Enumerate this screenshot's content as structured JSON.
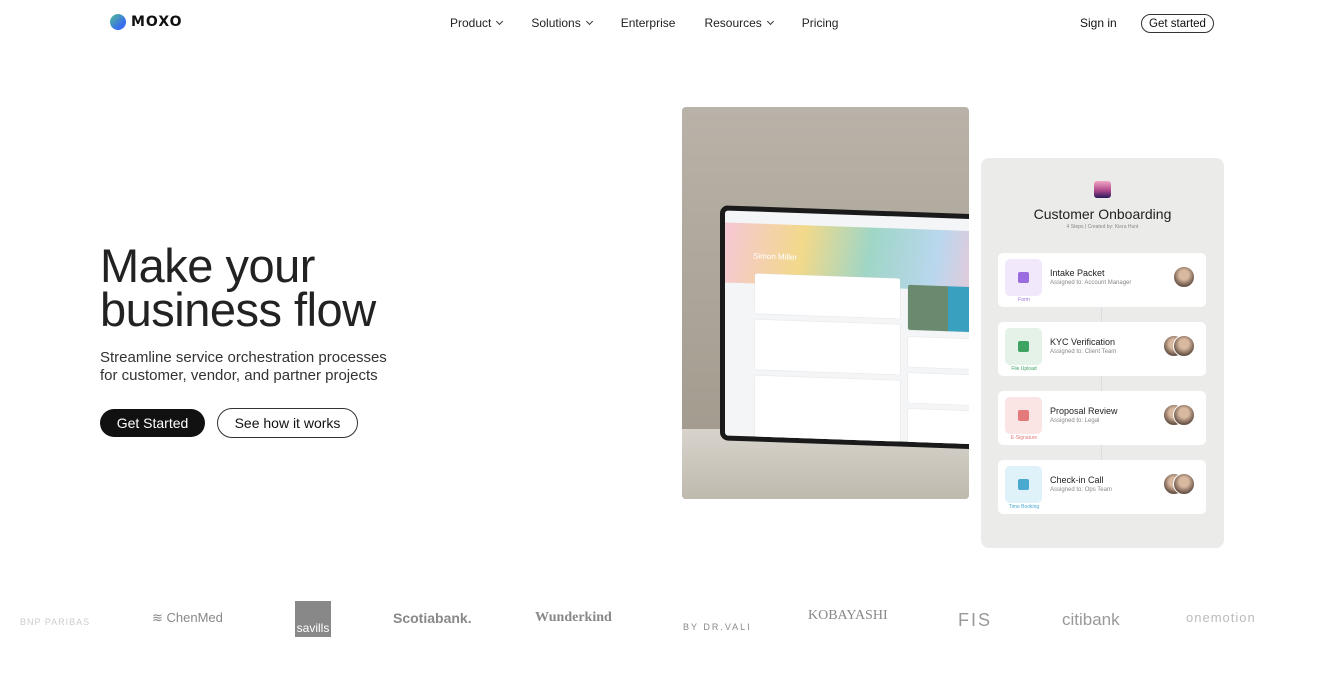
{
  "nav": {
    "brand": "MOXO",
    "items": [
      {
        "label": "Product",
        "dropdown": true
      },
      {
        "label": "Solutions",
        "dropdown": true
      },
      {
        "label": "Enterprise",
        "dropdown": false
      },
      {
        "label": "Resources",
        "dropdown": true
      },
      {
        "label": "Pricing",
        "dropdown": false
      }
    ],
    "sign_in": "Sign in",
    "get_started": "Get started"
  },
  "hero": {
    "title_line1": "Make your",
    "title_line2": "business flow",
    "subtitle_line1": "Streamline service orchestration processes",
    "subtitle_line2": "for customer, vendor, and partner projects",
    "primary_cta": "Get Started",
    "secondary_cta": "See how it works"
  },
  "monitor": {
    "user_name": "Simon Miller"
  },
  "workflow": {
    "title": "Customer Onboarding",
    "meta": "4 Steps | Created by: Kiera Hunt",
    "steps": [
      {
        "name": "Intake Packet",
        "assigned": "Assigned to: Account Manager",
        "type": "Form",
        "color": "#9b6be0",
        "bg": "#f1e9fb",
        "avatars": 1
      },
      {
        "name": "KYC Verification",
        "assigned": "Assigned to: Client Team",
        "type": "File Upload",
        "color": "#3fa364",
        "bg": "#e4f2e8",
        "avatars": 2
      },
      {
        "name": "Proposal Review",
        "assigned": "Assigned to: Legal",
        "type": "E-Signature",
        "color": "#e57a7a",
        "bg": "#fbe4e4",
        "avatars": 2
      },
      {
        "name": "Check-in Call",
        "assigned": "Assigned to: Ops Team",
        "type": "Time Booking",
        "color": "#4aa9cf",
        "bg": "#dff1f9",
        "avatars": 2
      }
    ]
  },
  "logos": [
    "BNP PARIBAS",
    "ChenMed",
    "savills",
    "Scotiabank.",
    "Wunderkind",
    "BY DR.VALI",
    "KOBAYASHI",
    "FIS",
    "citibank",
    "onemotion"
  ]
}
